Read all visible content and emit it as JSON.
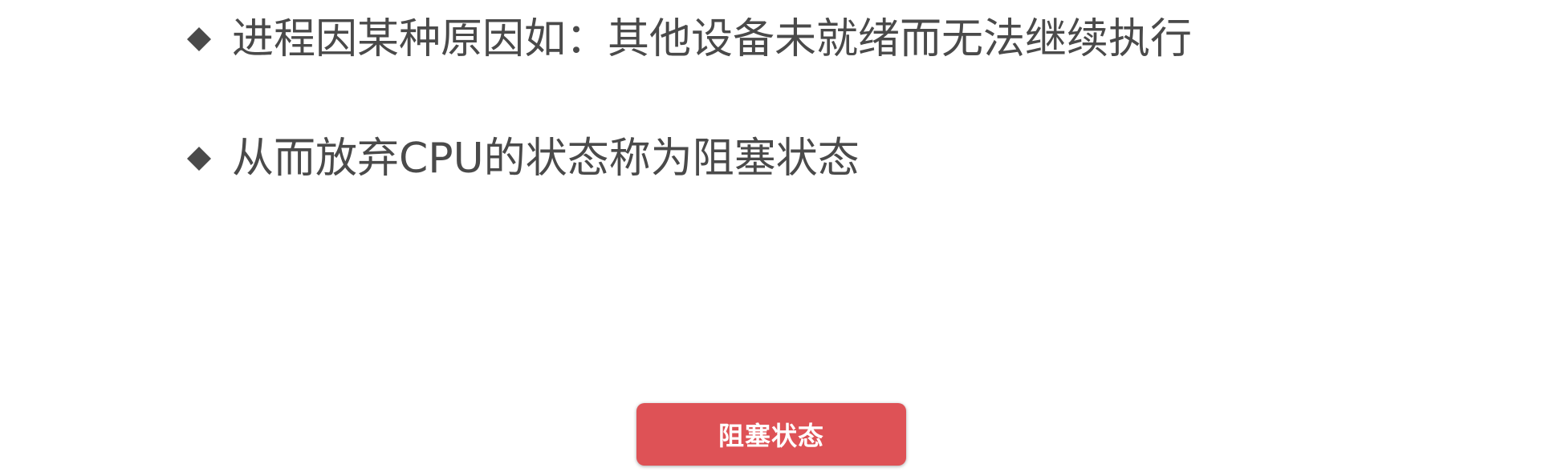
{
  "bullets": [
    {
      "icon": "diamond-bullet-icon",
      "text": "进程因某种原因如：其他设备未就绪而无法继续执行"
    },
    {
      "icon": "diamond-bullet-icon",
      "text": "从而放弃CPU的状态称为阻塞状态"
    }
  ],
  "tag": {
    "label": "阻塞状态",
    "color": "#de5256"
  },
  "colors": {
    "text": "#4a4a4a",
    "background": "#ffffff"
  }
}
